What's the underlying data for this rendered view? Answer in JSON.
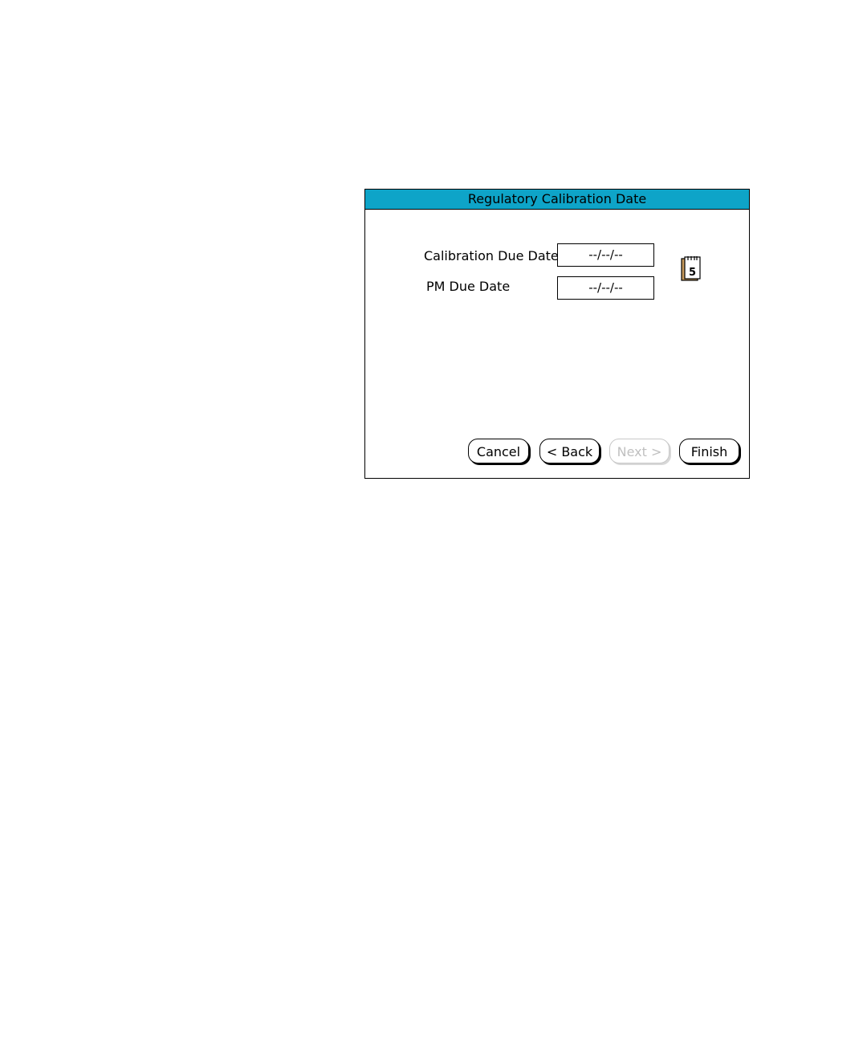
{
  "dialog": {
    "title": "Regulatory Calibration Date",
    "title_bg": "#0ea4c8"
  },
  "fields": {
    "calibration_due_date": {
      "label": "Calibration Due Date",
      "value": "--/--/--"
    },
    "pm_due_date": {
      "label": "PM Due Date",
      "value": "--/--/--"
    }
  },
  "calendar": {
    "icon": "calendar-icon",
    "day": "5"
  },
  "buttons": {
    "cancel": "Cancel",
    "back": "< Back",
    "next": "Next >",
    "next_enabled": false,
    "finish": "Finish"
  }
}
